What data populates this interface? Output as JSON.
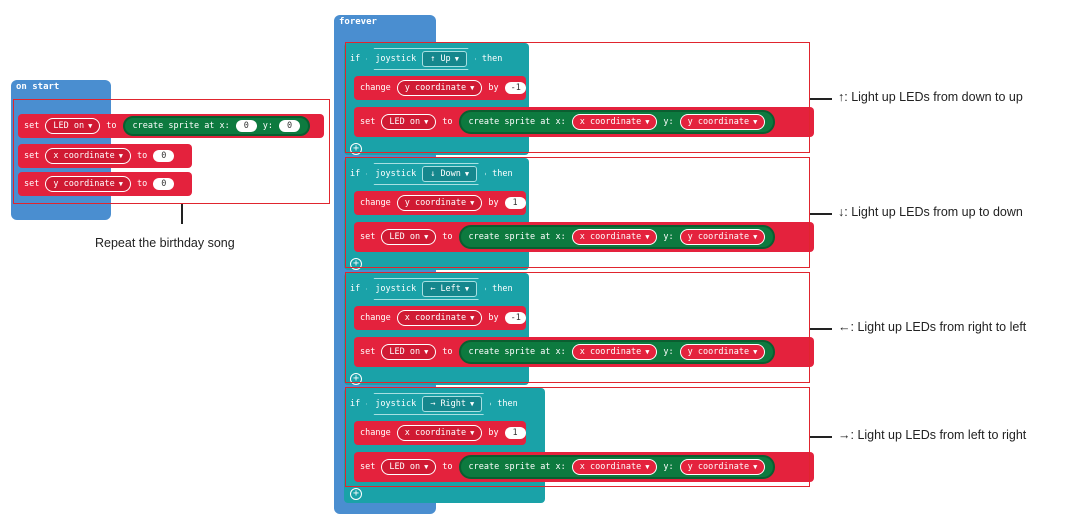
{
  "on_start": {
    "header": "on start",
    "set_kw": "set",
    "to_kw": "to",
    "led_var": "LED on",
    "create_sprite_label": "create sprite at x:",
    "y_label": "y:",
    "zero": "0",
    "x_var": "x coordinate",
    "y_var": "y coordinate",
    "annotation": "Repeat the birthday song"
  },
  "forever": {
    "header": "forever",
    "if_kw": "if",
    "then_kw": "then",
    "joystick_label": "joystick",
    "change_kw": "change",
    "by_kw": "by",
    "set_kw": "set",
    "to_kw": "to",
    "led_var": "LED on",
    "create_sprite_label": "create sprite at x:",
    "y_label": "y:",
    "x_var": "x coordinate",
    "y_var": "y coordinate",
    "blocks": [
      {
        "direction": "↑ Up",
        "change_var": "y coordinate",
        "by_value": "-1",
        "annotation": "↑: Light up LEDs from down to up"
      },
      {
        "direction": "↓ Down",
        "change_var": "y coordinate",
        "by_value": "1",
        "annotation": "↓: Light up LEDs from up to down"
      },
      {
        "direction": "← Left",
        "change_var": "x coordinate",
        "by_value": "-1",
        "annotation": "←: Light up LEDs from right to left"
      },
      {
        "direction": "→ Right",
        "change_var": "x coordinate",
        "by_value": "1",
        "annotation": "→: Light up LEDs from left to right"
      }
    ]
  },
  "icons": {
    "dropdown": "caret-down-icon",
    "add": "plus-circle-icon"
  },
  "colors": {
    "event_blue": "#4a8ed0",
    "logic_teal": "#1aa2a8",
    "variable_red": "#e4223d",
    "sprite_green": "#0d7a3f",
    "annotation_frame": "#e0252e"
  }
}
